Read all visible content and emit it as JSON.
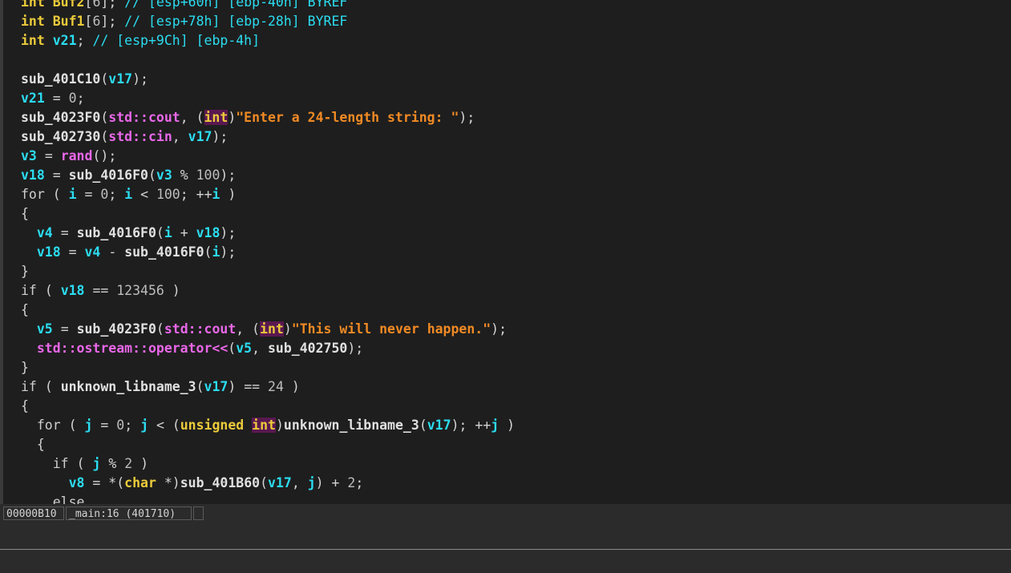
{
  "code_lines": [
    "int Buf2[6]; // [esp+60h] [ebp-40h] BYREF",
    "int Buf1[6]; // [esp+78h] [ebp-28h] BYREF",
    "int v21; // [esp+9Ch] [ebp-4h]",
    "",
    "sub_401C10(v17);",
    "v21 = 0;",
    "sub_4023F0(std::cout, (int)\"Enter a 24-length string: \");",
    "sub_402730(std::cin, v17);",
    "v3 = rand();",
    "v18 = sub_4016F0(v3 % 100);",
    "for ( i = 0; i < 100; ++i )",
    "{",
    "  v4 = sub_4016F0(i + v18);",
    "  v18 = v4 - sub_4016F0(i);",
    "}",
    "if ( v18 == 123456 )",
    "{",
    "  v5 = sub_4023F0(std::cout, (int)\"This will never happen.\");",
    "  std::ostream::operator<<(v5, sub_402750);",
    "}",
    "if ( unknown_libname_3(v17) == 24 )",
    "{",
    "  for ( j = 0; j < (unsigned int)unknown_libname_3(v17); ++j )",
    "  {",
    "    if ( j % 2 )",
    "      v8 = *(char *)sub_401B60(v17, j) + 2;",
    "    else"
  ],
  "status_bar": {
    "address": "00000B10",
    "location": "_main:16 (401710)",
    "extra": ""
  },
  "colors": {
    "background": "#1e1e1e",
    "keyword": "#ebcb3b",
    "variable": "#2bdcf0",
    "library": "#e867e8",
    "string": "#f08a24",
    "highlight": "#5a1850"
  }
}
